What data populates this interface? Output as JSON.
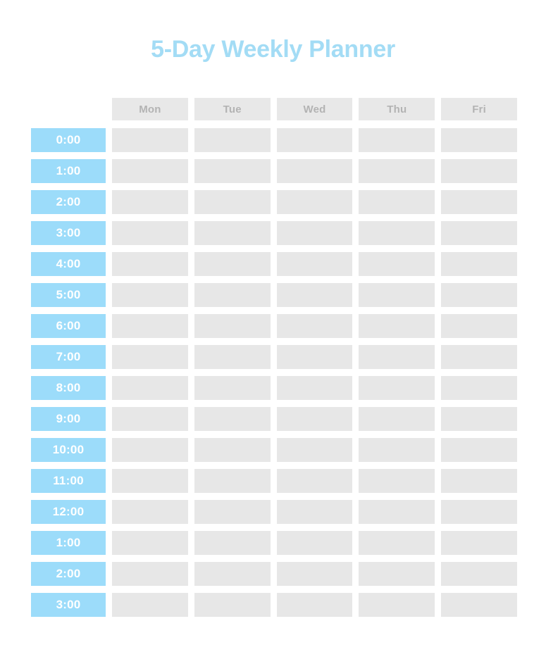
{
  "page": {
    "title": "5-Day Weekly Planner",
    "background_color": "#ffffff",
    "title_color": "#a3dcf5"
  },
  "colors": {
    "accent_blue": "#9cdcfa",
    "header_cell": "#e8e8e8",
    "header_text": "#b3b3b3",
    "slot_cell": "#e7e7e7",
    "time_label_text": "#ffffff"
  },
  "grid": {
    "day_headers": [
      "Mon",
      "Tue",
      "Wed",
      "Thu",
      "Fri"
    ],
    "time_labels": [
      "0:00",
      "1:00",
      "2:00",
      "3:00",
      "4:00",
      "5:00",
      "6:00",
      "7:00",
      "8:00",
      "9:00",
      "10:00",
      "11:00",
      "12:00",
      "1:00",
      "2:00",
      "3:00"
    ],
    "rows": [
      {
        "time": "0:00",
        "slots": [
          "",
          "",
          "",
          "",
          ""
        ]
      },
      {
        "time": "1:00",
        "slots": [
          "",
          "",
          "",
          "",
          ""
        ]
      },
      {
        "time": "2:00",
        "slots": [
          "",
          "",
          "",
          "",
          ""
        ]
      },
      {
        "time": "3:00",
        "slots": [
          "",
          "",
          "",
          "",
          ""
        ]
      },
      {
        "time": "4:00",
        "slots": [
          "",
          "",
          "",
          "",
          ""
        ]
      },
      {
        "time": "5:00",
        "slots": [
          "",
          "",
          "",
          "",
          ""
        ]
      },
      {
        "time": "6:00",
        "slots": [
          "",
          "",
          "",
          "",
          ""
        ]
      },
      {
        "time": "7:00",
        "slots": [
          "",
          "",
          "",
          "",
          ""
        ]
      },
      {
        "time": "8:00",
        "slots": [
          "",
          "",
          "",
          "",
          ""
        ]
      },
      {
        "time": "9:00",
        "slots": [
          "",
          "",
          "",
          "",
          ""
        ]
      },
      {
        "time": "10:00",
        "slots": [
          "",
          "",
          "",
          "",
          ""
        ]
      },
      {
        "time": "11:00",
        "slots": [
          "",
          "",
          "",
          "",
          ""
        ]
      },
      {
        "time": "12:00",
        "slots": [
          "",
          "",
          "",
          "",
          ""
        ]
      },
      {
        "time": "1:00",
        "slots": [
          "",
          "",
          "",
          "",
          ""
        ]
      },
      {
        "time": "2:00",
        "slots": [
          "",
          "",
          "",
          "",
          ""
        ]
      },
      {
        "time": "3:00",
        "slots": [
          "",
          "",
          "",
          "",
          ""
        ]
      }
    ]
  }
}
